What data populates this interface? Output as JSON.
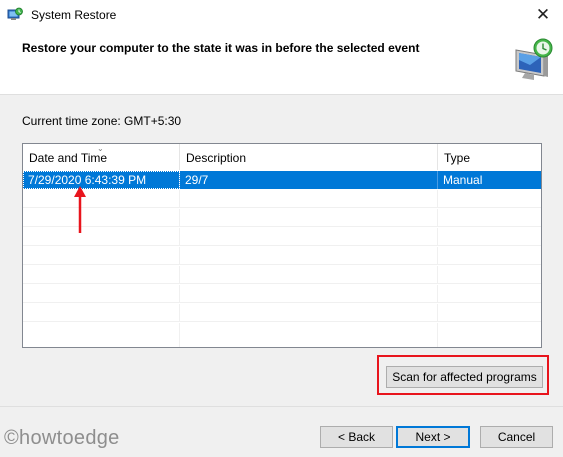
{
  "window": {
    "title": "System Restore",
    "close_glyph": "✕"
  },
  "header": {
    "title": "Restore your computer to the state it was in before the selected event",
    "icon": "system-restore-monitor-icon"
  },
  "timezone": {
    "text": "Current time zone: GMT+5:30"
  },
  "table": {
    "columns": [
      "Date and Time",
      "Description",
      "Type"
    ],
    "sort_glyph": "⌄",
    "rows": [
      {
        "date_time": "7/29/2020 6:43:39 PM",
        "description": "29/7",
        "type": "Manual",
        "selected": true
      }
    ],
    "empty_rows": 8
  },
  "buttons": {
    "scan": "Scan for affected programs",
    "back": "< Back",
    "next": "Next >",
    "cancel": "Cancel"
  },
  "annotations": {
    "highlight_color": "#e8141c",
    "arrow_color": "#e8141c"
  },
  "watermark": "©howtoedge",
  "colors": {
    "selection": "#0078d7",
    "background": "#f0f0f0"
  }
}
